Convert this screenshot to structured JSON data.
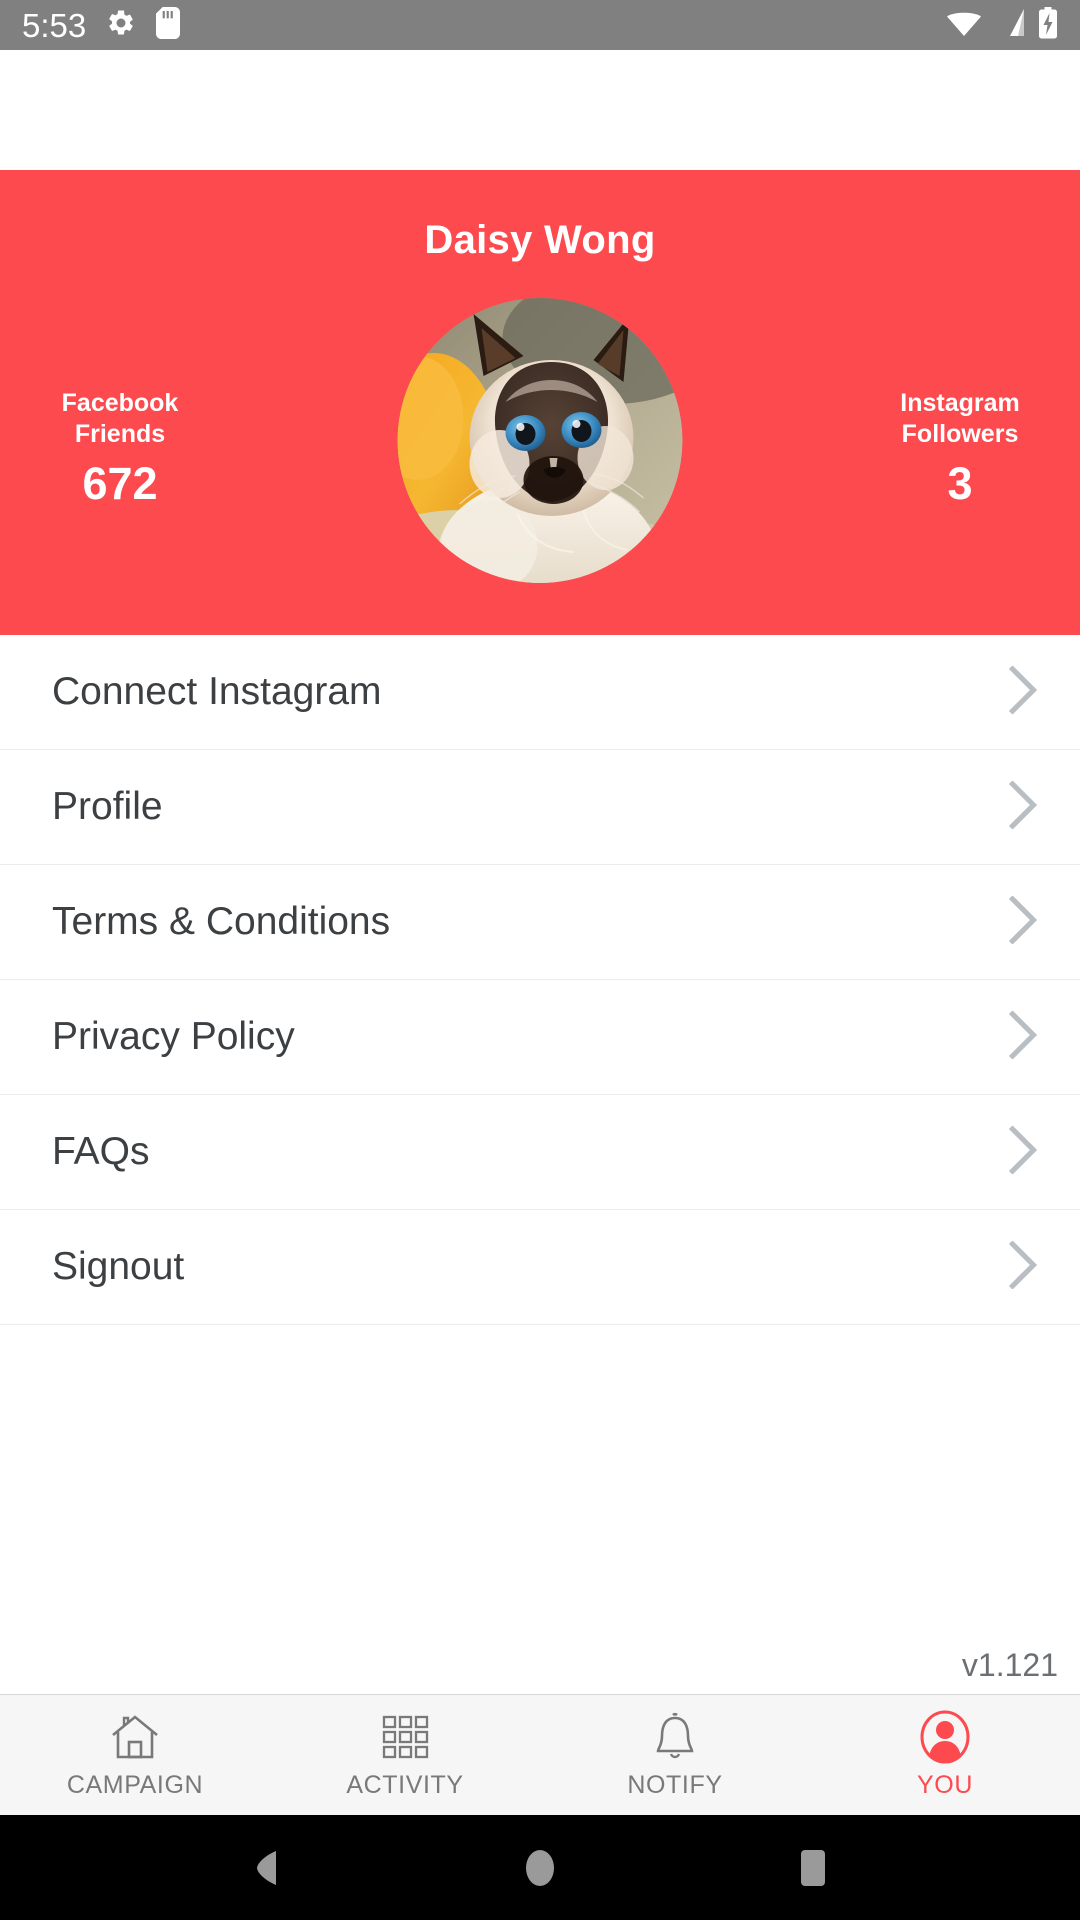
{
  "status_bar": {
    "time": "5:53",
    "left_icons": [
      "gear-icon",
      "sd-card-icon"
    ],
    "right_icons": [
      "wifi-icon",
      "cell-signal-icon",
      "battery-charging-icon"
    ],
    "background_color": "#808080"
  },
  "profile": {
    "name": "Daisy Wong",
    "accent_color": "#fc4a4f",
    "avatar": "cat-avatar-photo",
    "stats": [
      {
        "label_line1": "Facebook",
        "label_line2": "Friends",
        "value": "672"
      },
      {
        "label_line1": "Instagram",
        "label_line2": "Followers",
        "value": "3"
      }
    ]
  },
  "menu": {
    "items": [
      {
        "label": "Connect Instagram",
        "icon": "chevron-right-icon"
      },
      {
        "label": "Profile",
        "icon": "chevron-right-icon"
      },
      {
        "label": "Terms & Conditions",
        "icon": "chevron-right-icon"
      },
      {
        "label": "Privacy Policy",
        "icon": "chevron-right-icon"
      },
      {
        "label": "FAQs",
        "icon": "chevron-right-icon"
      },
      {
        "label": "Signout",
        "icon": "chevron-right-icon"
      }
    ]
  },
  "footer": {
    "version": "v1.121"
  },
  "tab_bar": {
    "active_color": "#fc4a4f",
    "inactive_color": "#79797b",
    "tabs": [
      {
        "label": "CAMPAIGN",
        "icon": "home-icon",
        "active": false
      },
      {
        "label": "ACTIVITY",
        "icon": "grid-icon",
        "active": false
      },
      {
        "label": "NOTIFY",
        "icon": "bell-icon",
        "active": false
      },
      {
        "label": "YOU",
        "icon": "person-icon",
        "active": true
      }
    ]
  },
  "nav_bar": {
    "buttons": [
      "back-icon",
      "home-circle-icon",
      "recents-square-icon"
    ]
  }
}
